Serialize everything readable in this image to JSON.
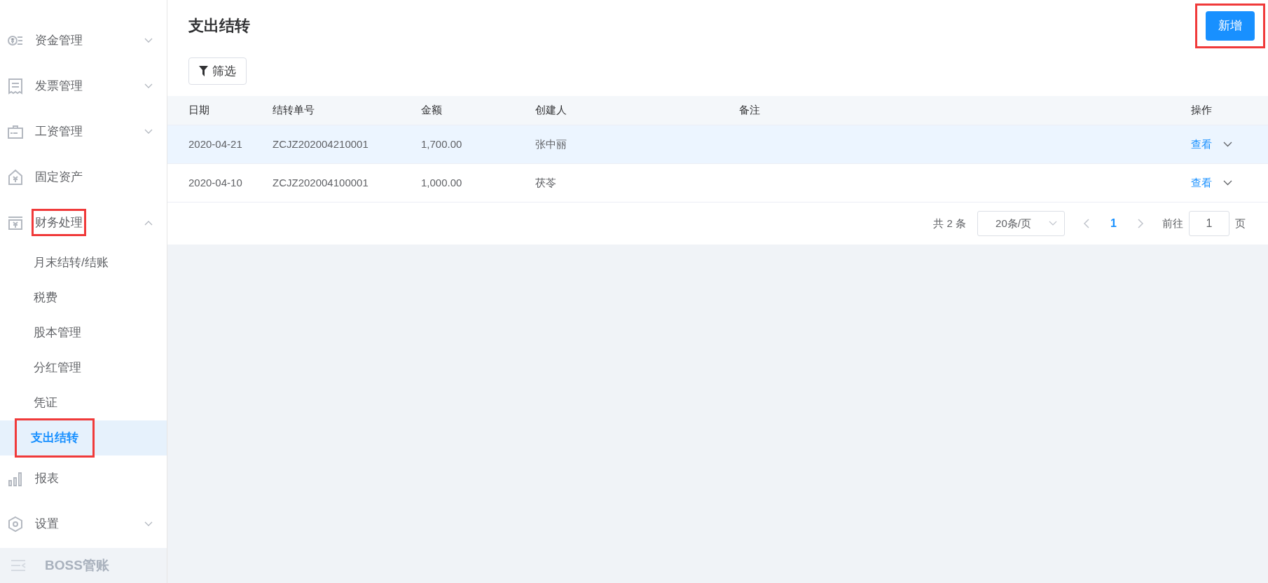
{
  "sidebar": {
    "items": [
      {
        "label": "资金管理",
        "expanded": false,
        "annotated": false
      },
      {
        "label": "发票管理",
        "expanded": false,
        "annotated": false
      },
      {
        "label": "工资管理",
        "expanded": false,
        "annotated": false
      },
      {
        "label": "固定资产",
        "annotated": false
      },
      {
        "label": "财务处理",
        "expanded": true,
        "annotated": true,
        "children": [
          {
            "label": "月末结转/结账",
            "selected": false,
            "annotated": false
          },
          {
            "label": "税费",
            "selected": false,
            "annotated": false
          },
          {
            "label": "股本管理",
            "selected": false,
            "annotated": false
          },
          {
            "label": "分红管理",
            "selected": false,
            "annotated": false
          },
          {
            "label": "凭证",
            "selected": false,
            "annotated": false
          },
          {
            "label": "支出结转",
            "selected": true,
            "annotated": true
          }
        ]
      },
      {
        "label": "报表",
        "annotated": false
      },
      {
        "label": "设置",
        "expanded": false,
        "annotated": false
      }
    ],
    "footer": "BOSS管账"
  },
  "page": {
    "title": "支出结转",
    "add_button": {
      "label": "新增",
      "annotated": true
    },
    "filter_button": "筛选"
  },
  "table": {
    "columns": [
      "日期",
      "结转单号",
      "金额",
      "创建人",
      "备注",
      "操作"
    ],
    "rows": [
      {
        "date": "2020-04-21",
        "number": "ZCJZ202004210001",
        "amount": "1,700.00",
        "creator": "张中丽",
        "action": "查看",
        "highlighted": true
      },
      {
        "date": "2020-04-10",
        "number": "ZCJZ202004100001",
        "amount": "1,000.00",
        "creator": "茯苓",
        "action": "查看",
        "highlighted": false
      }
    ]
  },
  "pagination": {
    "total": "共 2 条",
    "page_size": "20条/页",
    "pages": [
      {
        "label": "1",
        "selected": true
      }
    ],
    "goto_label": "前往",
    "goto_value": "1",
    "goto_suffix": "页"
  }
}
